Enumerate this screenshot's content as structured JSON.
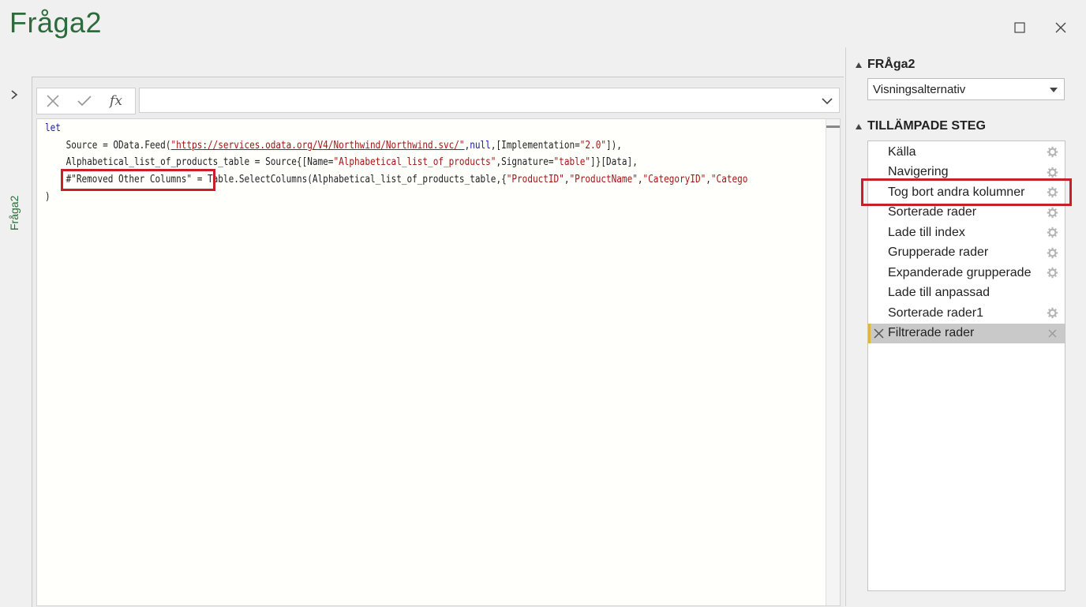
{
  "window": {
    "title": "Fråga2"
  },
  "left_rail": {
    "label": "Fråga2"
  },
  "formula_bar": {
    "fx_label": "fx",
    "value": ""
  },
  "code": {
    "line1": "let",
    "line2_a": "    Source = OData.Feed(",
    "line2_url": "\"https://services.odata.org/V4/Northwind/Northwind.svc/\"",
    "line2_b": ",",
    "line2_null": "null",
    "line2_c": ",[Implementation=",
    "line2_ver": "\"2.0\"",
    "line2_d": "]),",
    "line3_a": "    Alphabetical_list_of_products_table = Source{[Name=",
    "line3_s1": "\"Alphabetical_list_of_products\"",
    "line3_b": ",Signature=",
    "line3_s2": "\"table\"",
    "line3_c": "]}[Data],",
    "line4_step": "#\"Removed Other Columns\"",
    "line4_a": " = Table.SelectColumns(Alphabetical_list_of_products_table,{",
    "line4_s1": "\"ProductID\"",
    "line4_s2": "\"ProductName\"",
    "line4_s3": "\"CategoryID\"",
    "line4_s4": "\"Catego",
    "comma": ",",
    "line5": ")"
  },
  "query_settings": {
    "properties_header": "FRÅga2",
    "view_option": "Visningsalternativ",
    "applied_steps_header": "TILLÄMPADE STEG",
    "steps": [
      {
        "label": "Källa",
        "gear": true
      },
      {
        "label": "Navigering",
        "gear": true
      },
      {
        "label": "Tog bort andra kolumner",
        "gear": true
      },
      {
        "label": "Sorterade rader",
        "gear": true
      },
      {
        "label": "Lade till index",
        "gear": true
      },
      {
        "label": "Grupperade rader",
        "gear": true
      },
      {
        "label": "Expanderade grupperade",
        "gear": true
      },
      {
        "label": "Lade till anpassad",
        "gear": false
      },
      {
        "label": "Sorterade rader1",
        "gear": true
      },
      {
        "label": "Filtrerade rader",
        "gear": false,
        "active": true
      }
    ]
  },
  "colors": {
    "highlight": "#c8202a",
    "title_green": "#2e6b3b",
    "active_bar": "#e1b73a"
  }
}
